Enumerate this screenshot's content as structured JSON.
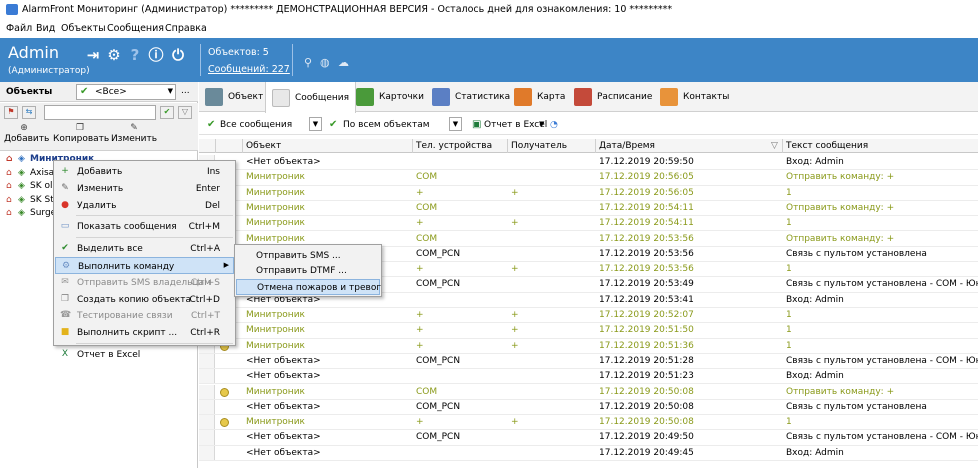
{
  "window": {
    "title": "AlarmFront Мониторинг (Администратор) ********* ДЕМОНСТРАЦИОННАЯ ВЕРСИЯ - Осталось дней для ознакомления: 10 *********"
  },
  "menu": [
    "Файл",
    "Вид",
    "Объекты",
    "Сообщения",
    "Справка"
  ],
  "header": {
    "user": "Admin",
    "role": "(Администратор)",
    "objects_label": "Объектов:  5",
    "messages_label": "Сообщений:  227"
  },
  "left": {
    "title": "Объекты",
    "filter_value": "<Все>",
    "more": "...",
    "actions": [
      "Добавить",
      "Копировать",
      "Изменить"
    ],
    "tree": [
      "Минитроник",
      "Axisa",
      "SK ol",
      "SK St",
      "Surge"
    ]
  },
  "tabs": [
    "Объект",
    "Сообщения",
    "Карточки",
    "Статистика",
    "Карта",
    "Расписание",
    "Контакты"
  ],
  "filters": {
    "messages": "Все сообщения",
    "objects": "По всем объектам",
    "excel": "Отчет в Excel"
  },
  "grid": {
    "columns": [
      "Объект",
      "Тел. устройства",
      "Получатель",
      "Дата/Время",
      "Текст сообщения"
    ],
    "rows": [
      {
        "obj": "<Нет объекта>",
        "tel": "",
        "rec": "",
        "dt": "17.12.2019 20:59:50",
        "txt": "Вход: Admin",
        "olive": false,
        "icon": false
      },
      {
        "obj": "Минитроник",
        "tel": "COM",
        "rec": "",
        "dt": "17.12.2019 20:56:05",
        "txt": "Отправить команду: +",
        "olive": true,
        "icon": false
      },
      {
        "obj": "Минитроник",
        "tel": "+",
        "rec": "+",
        "dt": "17.12.2019 20:56:05",
        "txt": "1",
        "olive": true,
        "icon": false
      },
      {
        "obj": "Минитроник",
        "tel": "COM",
        "rec": "",
        "dt": "17.12.2019 20:54:11",
        "txt": "Отправить команду: +",
        "olive": true,
        "icon": false
      },
      {
        "obj": "Минитроник",
        "tel": "+",
        "rec": "+",
        "dt": "17.12.2019 20:54:11",
        "txt": "1",
        "olive": true,
        "icon": false
      },
      {
        "obj": "Минитроник",
        "tel": "COM",
        "rec": "",
        "dt": "17.12.2019 20:53:56",
        "txt": "Отправить команду: +",
        "olive": true,
        "icon": false
      },
      {
        "obj": "<Нет объекта>",
        "tel": "COM_PCN",
        "rec": "",
        "dt": "17.12.2019 20:53:56",
        "txt": "Связь с пультом установлена",
        "olive": false,
        "icon": false
      },
      {
        "obj": "Минитроник",
        "tel": "+",
        "rec": "+",
        "dt": "17.12.2019 20:53:56",
        "txt": "1",
        "olive": true,
        "icon": false
      },
      {
        "obj": "<Нет объекта>",
        "tel": "COM_PCN",
        "rec": "",
        "dt": "17.12.2019 20:53:49",
        "txt": "Связь с пультом установлена - COM - Юнитес",
        "olive": false,
        "icon": false
      },
      {
        "obj": "<Нет объекта>",
        "tel": "",
        "rec": "",
        "dt": "17.12.2019 20:53:41",
        "txt": "Вход: Admin",
        "olive": false,
        "icon": false
      },
      {
        "obj": "Минитроник",
        "tel": "+",
        "rec": "+",
        "dt": "17.12.2019 20:52:07",
        "txt": "1",
        "olive": true,
        "icon": false
      },
      {
        "obj": "Минитроник",
        "tel": "+",
        "rec": "+",
        "dt": "17.12.2019 20:51:50",
        "txt": "1",
        "olive": true,
        "icon": false
      },
      {
        "obj": "Минитроник",
        "tel": "+",
        "rec": "+",
        "dt": "17.12.2019 20:51:36",
        "txt": "1",
        "olive": true,
        "icon": true
      },
      {
        "obj": "<Нет объекта>",
        "tel": "COM_PCN",
        "rec": "",
        "dt": "17.12.2019 20:51:28",
        "txt": "Связь с пультом установлена - COM - Юнитес",
        "olive": false,
        "icon": false
      },
      {
        "obj": "<Нет объекта>",
        "tel": "",
        "rec": "",
        "dt": "17.12.2019 20:51:23",
        "txt": "Вход: Admin",
        "olive": false,
        "icon": false
      },
      {
        "obj": "Минитроник",
        "tel": "COM",
        "rec": "",
        "dt": "17.12.2019 20:50:08",
        "txt": "Отправить команду: +",
        "olive": true,
        "icon": true
      },
      {
        "obj": "<Нет объекта>",
        "tel": "COM_PCN",
        "rec": "",
        "dt": "17.12.2019 20:50:08",
        "txt": "Связь с пультом установлена",
        "olive": false,
        "icon": false
      },
      {
        "obj": "Минитроник",
        "tel": "+",
        "rec": "+",
        "dt": "17.12.2019 20:50:08",
        "txt": "1",
        "olive": true,
        "icon": true
      },
      {
        "obj": "<Нет объекта>",
        "tel": "COM_PCN",
        "rec": "",
        "dt": "17.12.2019 20:49:50",
        "txt": "Связь с пультом установлена - COM - Юнитес",
        "olive": false,
        "icon": false
      },
      {
        "obj": "<Нет объекта>",
        "tel": "",
        "rec": "",
        "dt": "17.12.2019 20:49:45",
        "txt": "Вход: Admin",
        "olive": false,
        "icon": false
      }
    ]
  },
  "context_menu": [
    {
      "label": "Добавить",
      "shortcut": "Ins",
      "icon": "+",
      "icolor": "#2e8b2e",
      "disabled": false
    },
    {
      "label": "Изменить",
      "shortcut": "Enter",
      "icon": "✎",
      "icolor": "#666",
      "disabled": false
    },
    {
      "label": "Удалить",
      "shortcut": "Del",
      "icon": "●",
      "icolor": "#d9352a",
      "disabled": false
    },
    {
      "sep": true
    },
    {
      "label": "Показать сообщения",
      "shortcut": "Ctrl+M",
      "icon": "▭",
      "icolor": "#6a8fc4",
      "disabled": false
    },
    {
      "sep": true
    },
    {
      "label": "Выделить все",
      "shortcut": "Ctrl+A",
      "icon": "✔",
      "icolor": "#2e8b2e",
      "disabled": false
    },
    {
      "label": "Выполнить команду",
      "shortcut": "",
      "icon": "⚙",
      "icolor": "#6a8fc4",
      "disabled": false,
      "submenu": true,
      "highlight": true
    },
    {
      "label": "Отправить SMS владельцам",
      "shortcut": "Ctrl+S",
      "icon": "✉",
      "icolor": "#999",
      "disabled": true
    },
    {
      "label": "Создать копию объекта",
      "shortcut": "Ctrl+D",
      "icon": "❐",
      "icolor": "#888",
      "disabled": false
    },
    {
      "label": "Тестирование связи",
      "shortcut": "Ctrl+T",
      "icon": "☎",
      "icolor": "#999",
      "disabled": true
    },
    {
      "label": "Выполнить скрипт ...",
      "shortcut": "Ctrl+R",
      "icon": "■",
      "icolor": "#e3b31c",
      "disabled": false
    },
    {
      "sep": true
    },
    {
      "label": "Отчет в Excel",
      "shortcut": "",
      "icon": "X",
      "icolor": "#1e7b3a",
      "disabled": false
    }
  ],
  "submenu": [
    "Отправить SMS ...",
    "Отправить DTMF ...",
    "Отмена пожаров и тревог"
  ]
}
